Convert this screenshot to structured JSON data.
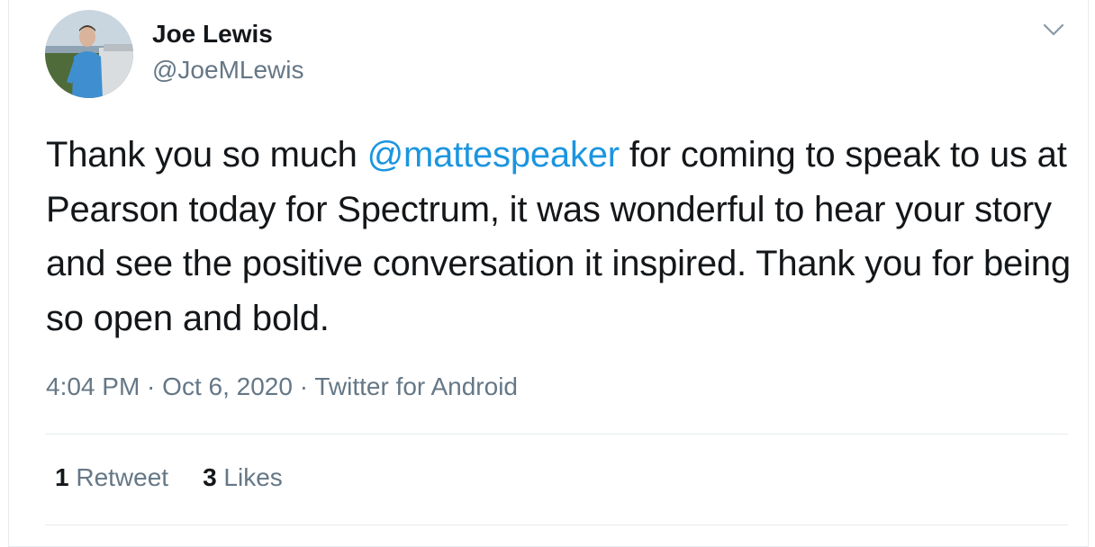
{
  "user": {
    "name": "Joe Lewis",
    "handle": "@JoeMLewis"
  },
  "tweet": {
    "text_before_mention": "Thank you so much ",
    "mention": "@mattespeaker",
    "text_after_mention": " for coming to speak to us at Pearson today for Spectrum, it was wonderful to hear your story and see the positive conversation it inspired. Thank you for being so open and bold."
  },
  "meta": {
    "time": "4:04 PM",
    "separator": " · ",
    "date": "Oct 6, 2020",
    "source": "Twitter for Android"
  },
  "stats": {
    "retweets_count": "1",
    "retweets_label": " Retweet",
    "likes_count": "3",
    "likes_label": " Likes"
  },
  "icons": {
    "menu": "chevron-down-icon"
  },
  "colors": {
    "text": "#14171a",
    "secondary": "#657786",
    "link": "#1b95e0",
    "border": "#e6ecf0"
  }
}
